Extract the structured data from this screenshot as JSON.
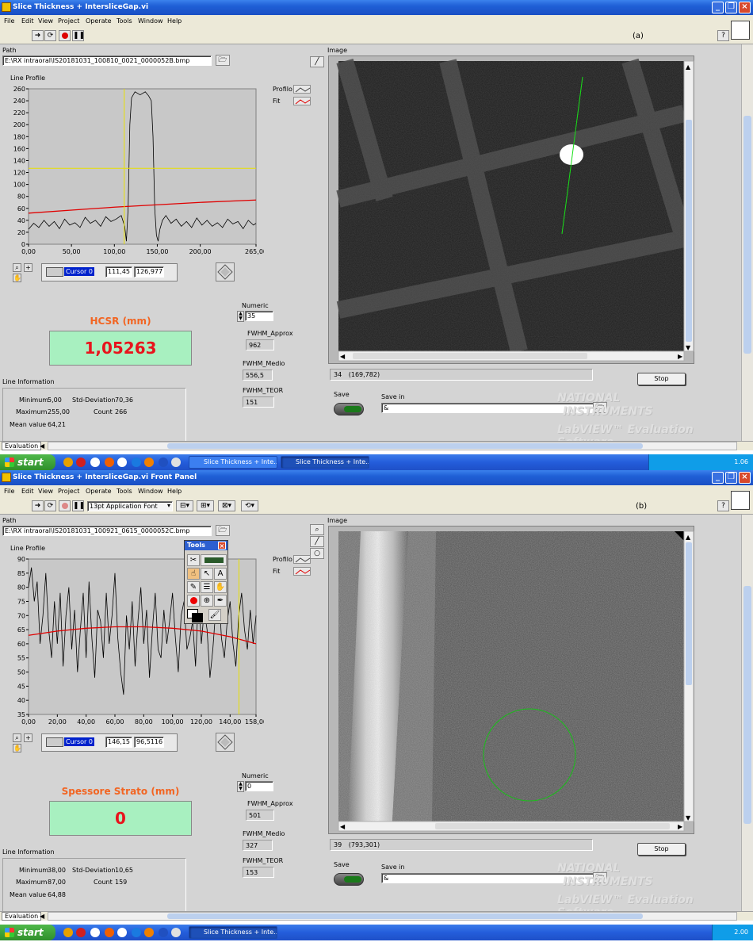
{
  "colors": {
    "accent_orange": "#f26522",
    "value_red": "#e8141c",
    "value_bg": "#a8f0c0",
    "fit_red": "#e00000",
    "cursor_yellow": "#e8e000",
    "roi_green": "#00d000"
  },
  "top": {
    "title": "Slice Thickness + IntersliceGap.vi",
    "menu": [
      "File",
      "Edit",
      "View",
      "Project",
      "Operate",
      "Tools",
      "Window",
      "Help"
    ],
    "label": "(a)",
    "path_label": "Path",
    "path_value": "E:\\RX intraoral\\IS20181031_100810_0021_0000052B.bmp",
    "line_profile_label": "Line Profile",
    "legend_profile": "Profilo",
    "legend_fit": "Fit",
    "cursor_name": "Cursor 0",
    "cursor_x": "111,45",
    "cursor_y": "126,977",
    "numeric_label": "Numeric",
    "numeric_value": "35",
    "result_title": "HCSR (mm)",
    "result_value": "1,05263",
    "fwhm_approx_label": "FWHM_Approx",
    "fwhm_approx_value": "962",
    "fwhm_medio_label": "FWHM_Medio",
    "fwhm_medio_value": "556,5",
    "fwhm_teor_label": "FWHM_TEOR",
    "fwhm_teor_value": "151",
    "line_info_label": "Line Information",
    "minimum_label": "Minimum",
    "minimum_value": "5,00",
    "maximum_label": "Maximum",
    "maximum_value": "255,00",
    "mean_label": "Mean value",
    "mean_value": "64,21",
    "std_label": "Std-Deviation",
    "std_value": "70,36",
    "count_label": "Count",
    "count_value": "266",
    "image_label": "Image",
    "image_status_num": "34",
    "image_status_coords": "(169,782)",
    "stop_label": "Stop",
    "save_label": "Save",
    "save_in_label": "Save in",
    "save_in_value": "&",
    "ni_line1": "NATIONAL",
    "ni_line2": "INSTRUMENTS",
    "ni_line3": "LabVIEW™ Evaluation Software",
    "eval_tab": "Evaluation",
    "taskbar_start": "start",
    "taskbar_tasks": [
      "Slice Thickness + Inte...",
      "Slice Thickness + Inte..."
    ],
    "taskbar_time": "1.06"
  },
  "bottom": {
    "title": "Slice Thickness + IntersliceGap.vi Front Panel",
    "menu": [
      "File",
      "Edit",
      "View",
      "Project",
      "Operate",
      "Tools",
      "Window",
      "Help"
    ],
    "label": "(b)",
    "font_select": "13pt Application Font",
    "path_label": "Path",
    "path_value": "E:\\RX intraoral\\IS20181031_100921_0615_0000052C.bmp",
    "line_profile_label": "Line Profile",
    "legend_profile": "Profilo",
    "legend_fit": "Fit",
    "tools_title": "Tools",
    "cursor_name": "Cursor 0",
    "cursor_x": "146,15",
    "cursor_y": "96,5116",
    "numeric_label": "Numeric",
    "numeric_value": "0",
    "result_title": "Spessore Strato (mm)",
    "result_value": "0",
    "fwhm_approx_label": "FWHM_Approx",
    "fwhm_approx_value": "501",
    "fwhm_medio_label": "FWHM_Medio",
    "fwhm_medio_value": "327",
    "fwhm_teor_label": "FWHM_TEOR",
    "fwhm_teor_value": "153",
    "line_info_label": "Line Information",
    "minimum_label": "Minimum",
    "minimum_value": "38,00",
    "maximum_label": "Maximum",
    "maximum_value": "87,00",
    "mean_label": "Mean value",
    "mean_value": "64,88",
    "std_label": "Std-Deviation",
    "std_value": "10,65",
    "count_label": "Count",
    "count_value": "159",
    "image_label": "Image",
    "image_status_num": "39",
    "image_status_coords": "(793,301)",
    "stop_label": "Stop",
    "save_label": "Save",
    "save_in_label": "Save in",
    "save_in_value": "&",
    "ni_line1": "NATIONAL",
    "ni_line2": "INSTRUMENTS",
    "ni_line3": "LabVIEW™ Evaluation Software",
    "eval_tab": "Evaluation",
    "taskbar_start": "start",
    "taskbar_tasks": [
      "Slice Thickness + Inte..."
    ],
    "taskbar_time": "2.00"
  },
  "chart_data": [
    {
      "type": "line",
      "title": "Line Profile",
      "xlim": [
        0,
        265
      ],
      "ylim": [
        0,
        260
      ],
      "x_ticks": [
        "0,00",
        "50,00",
        "100,00",
        "150,00",
        "200,00",
        "265,00"
      ],
      "y_ticks": [
        "0",
        "20",
        "40",
        "60",
        "80",
        "100",
        "120",
        "140",
        "160",
        "180",
        "200",
        "220",
        "240",
        "260"
      ],
      "cursor": {
        "x": 111.45,
        "y": 126.977
      },
      "series": [
        {
          "name": "Profilo",
          "x": [
            0,
            6,
            12,
            18,
            24,
            30,
            36,
            42,
            48,
            54,
            60,
            66,
            72,
            78,
            84,
            90,
            96,
            102,
            108,
            112,
            114,
            116,
            118,
            120,
            124,
            130,
            136,
            140,
            143,
            145,
            147,
            149,
            151,
            153,
            156,
            160,
            166,
            172,
            178,
            184,
            190,
            196,
            202,
            208,
            214,
            220,
            226,
            232,
            238,
            244,
            250,
            256,
            262,
            265
          ],
          "y": [
            25,
            35,
            28,
            40,
            30,
            38,
            26,
            42,
            32,
            36,
            28,
            45,
            35,
            40,
            30,
            46,
            38,
            42,
            48,
            30,
            5,
            60,
            200,
            245,
            255,
            250,
            255,
            248,
            240,
            180,
            60,
            15,
            5,
            25,
            40,
            48,
            35,
            42,
            30,
            38,
            28,
            44,
            32,
            40,
            30,
            36,
            28,
            42,
            34,
            38,
            26,
            40,
            32,
            35
          ]
        },
        {
          "name": "Fit",
          "x": [
            0,
            50,
            100,
            150,
            200,
            265
          ],
          "y": [
            52,
            57,
            62,
            66,
            70,
            74
          ]
        }
      ]
    },
    {
      "type": "line",
      "title": "Line Profile",
      "xlim": [
        0,
        158
      ],
      "ylim": [
        35,
        90
      ],
      "x_ticks": [
        "0,00",
        "20,00",
        "40,00",
        "60,00",
        "80,00",
        "100,00",
        "120,00",
        "140,00",
        "158,00"
      ],
      "y_ticks": [
        "35",
        "40",
        "45",
        "50",
        "55",
        "60",
        "65",
        "70",
        "75",
        "80",
        "85",
        "90"
      ],
      "cursor": {
        "x": 146.15,
        "y": 96.5116
      },
      "series": [
        {
          "name": "Profilo",
          "x": [
            0,
            2,
            4,
            6,
            8,
            10,
            12,
            14,
            16,
            18,
            20,
            22,
            24,
            26,
            28,
            30,
            32,
            34,
            36,
            38,
            40,
            42,
            44,
            46,
            48,
            50,
            52,
            54,
            56,
            58,
            60,
            62,
            64,
            66,
            68,
            70,
            72,
            74,
            76,
            78,
            80,
            82,
            84,
            86,
            88,
            90,
            92,
            94,
            96,
            98,
            100,
            102,
            104,
            106,
            108,
            110,
            112,
            114,
            116,
            118,
            120,
            122,
            124,
            126,
            128,
            130,
            132,
            134,
            136,
            138,
            140,
            142,
            144,
            146,
            148,
            150,
            152,
            154,
            156,
            158
          ],
          "y": [
            80,
            87,
            75,
            82,
            60,
            70,
            85,
            65,
            55,
            75,
            60,
            78,
            52,
            70,
            80,
            58,
            72,
            50,
            65,
            78,
            55,
            82,
            62,
            48,
            72,
            68,
            55,
            78,
            60,
            70,
            85,
            62,
            50,
            42,
            70,
            58,
            75,
            52,
            68,
            80,
            60,
            72,
            48,
            65,
            78,
            58,
            55,
            72,
            60,
            68,
            78,
            62,
            50,
            70,
            75,
            58,
            62,
            68,
            52,
            78,
            60,
            72,
            65,
            48,
            58,
            72,
            80,
            62,
            55,
            68,
            75,
            60,
            52,
            70,
            78,
            65,
            58,
            72,
            60,
            70
          ]
        },
        {
          "name": "Fit",
          "x": [
            0,
            20,
            40,
            60,
            80,
            100,
            120,
            140,
            158
          ],
          "y": [
            63,
            64.5,
            65.5,
            66,
            66,
            65.5,
            64.5,
            62.5,
            60
          ]
        }
      ]
    }
  ]
}
